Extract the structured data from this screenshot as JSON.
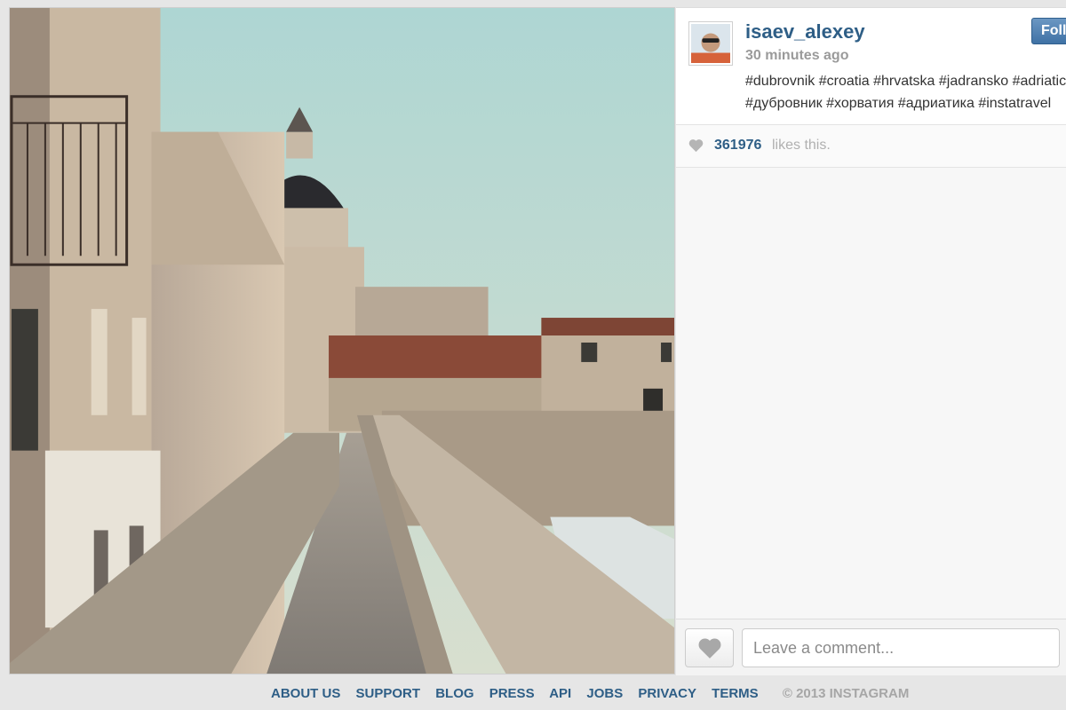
{
  "post": {
    "username": "isaev_alexey",
    "time": "30 minutes ago",
    "follow_label": "Follow",
    "caption_lines": [
      "#dubrovnik #croatia #hrvatska #jadransko #adriatic",
      "#дубровник #хорватия #адриатика #instatravel"
    ]
  },
  "likes": {
    "count": "361976",
    "text": "likes this."
  },
  "comment": {
    "placeholder": "Leave a comment..."
  },
  "footer": {
    "links": [
      "ABOUT US",
      "SUPPORT",
      "BLOG",
      "PRESS",
      "API",
      "JOBS",
      "PRIVACY",
      "TERMS"
    ],
    "copyright": "© 2013 INSTAGRAM"
  },
  "colors": {
    "link_blue": "#2e5e86",
    "follow_button": "#4a7cb0",
    "panel_bg": "#f7f7f7",
    "sky": "#b7d8d4",
    "roof": "#8a4a38"
  },
  "icons": [
    "heart-icon",
    "avatar"
  ]
}
